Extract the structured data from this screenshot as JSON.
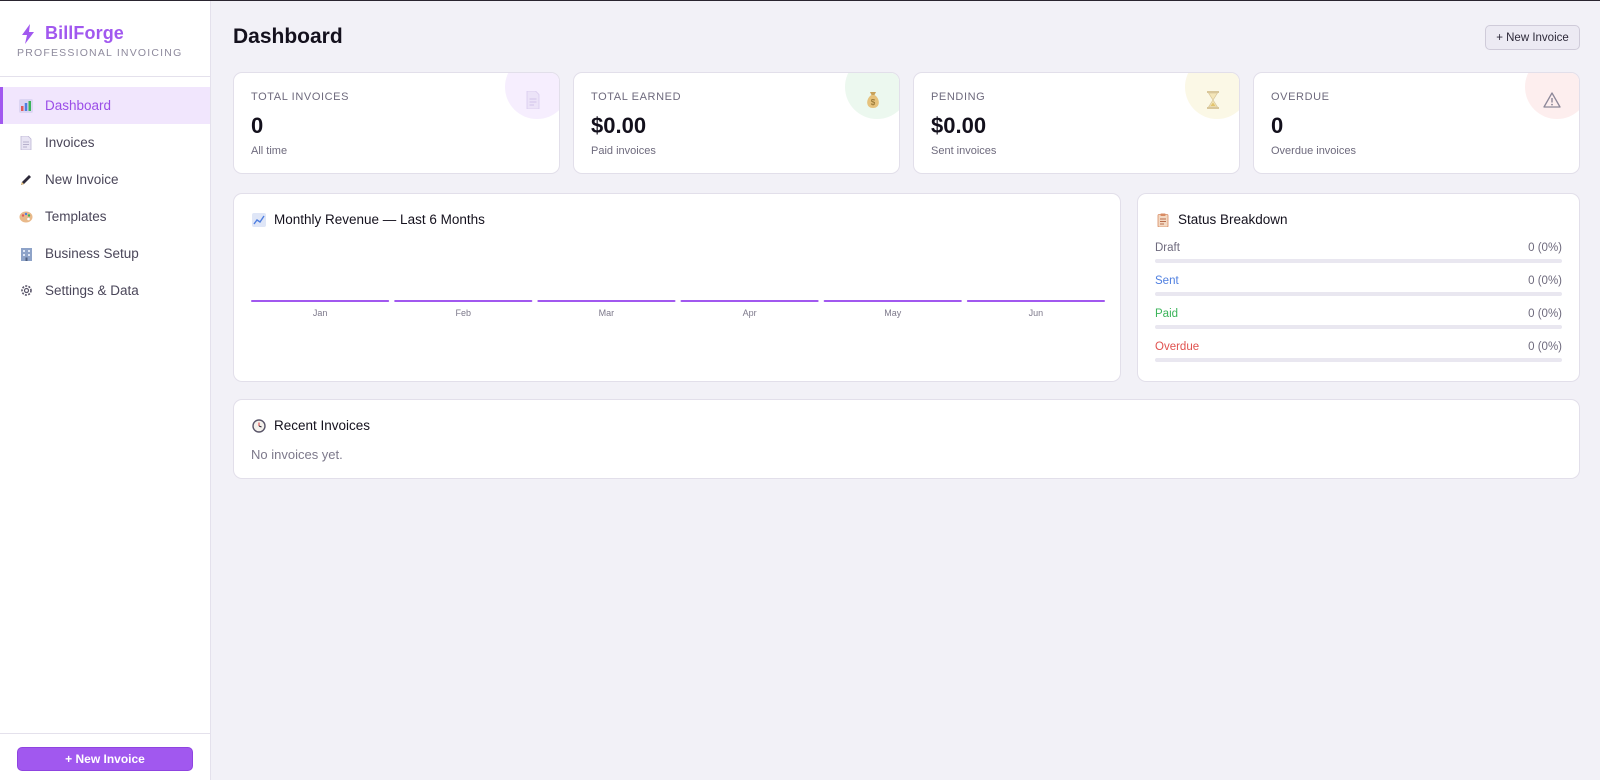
{
  "brand": {
    "name": "BillForge",
    "tagline": "PROFESSIONAL INVOICING"
  },
  "sidebar": {
    "items": [
      {
        "label": "Dashboard",
        "icon": "bar-chart-icon",
        "active": true
      },
      {
        "label": "Invoices",
        "icon": "document-icon",
        "active": false
      },
      {
        "label": "New Invoice",
        "icon": "pen-icon",
        "active": false
      },
      {
        "label": "Templates",
        "icon": "palette-icon",
        "active": false
      },
      {
        "label": "Business Setup",
        "icon": "building-icon",
        "active": false
      },
      {
        "label": "Settings & Data",
        "icon": "gear-icon",
        "active": false
      }
    ],
    "footer_button": "+ New Invoice"
  },
  "header": {
    "title": "Dashboard",
    "new_invoice_button": "+ New Invoice"
  },
  "stats": [
    {
      "label": "TOTAL INVOICES",
      "value": "0",
      "sub": "All time",
      "icon": "document-icon",
      "circle_color": "#f6eefe"
    },
    {
      "label": "TOTAL EARNED",
      "value": "$0.00",
      "sub": "Paid invoices",
      "icon": "money-bag-icon",
      "circle_color": "#ecf8ef"
    },
    {
      "label": "PENDING",
      "value": "$0.00",
      "sub": "Sent invoices",
      "icon": "hourglass-icon",
      "circle_color": "#fbf8e6"
    },
    {
      "label": "OVERDUE",
      "value": "0",
      "sub": "Overdue invoices",
      "icon": "warning-icon",
      "circle_color": "#fdeeee"
    }
  ],
  "revenue": {
    "title": "Monthly Revenue — Last 6 Months",
    "icon": "line-chart-icon"
  },
  "chart_data": {
    "type": "bar",
    "title": "Monthly Revenue — Last 6 Months",
    "categories": [
      "Jan",
      "Feb",
      "Mar",
      "Apr",
      "May",
      "Jun"
    ],
    "values": [
      0,
      0,
      0,
      0,
      0,
      0
    ],
    "bar_color": "#a158ef"
  },
  "status_breakdown": {
    "title": "Status Breakdown",
    "icon": "clipboard-icon",
    "rows": [
      {
        "label": "Draft",
        "value": "0 (0%)",
        "fraction": 0,
        "color": "#6e6a7d"
      },
      {
        "label": "Sent",
        "value": "0 (0%)",
        "fraction": 0,
        "color": "#4f7fe0"
      },
      {
        "label": "Paid",
        "value": "0 (0%)",
        "fraction": 0,
        "color": "#3bb45a"
      },
      {
        "label": "Overdue",
        "value": "0 (0%)",
        "fraction": 0,
        "color": "#e0524f"
      }
    ]
  },
  "recent": {
    "title": "Recent Invoices",
    "icon": "clock-icon",
    "empty": "No invoices yet."
  },
  "colors": {
    "accent": "#a158ef",
    "background": "#f2f1f7"
  }
}
